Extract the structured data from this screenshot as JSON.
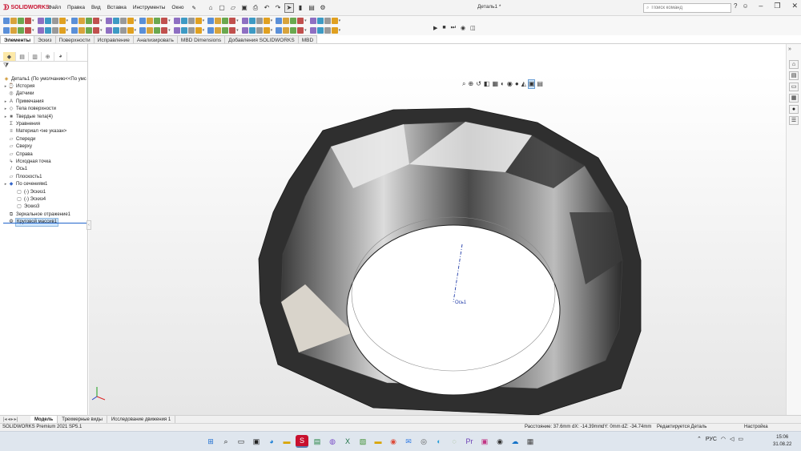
{
  "app": {
    "brand": "SOLIDWORKS",
    "document_title": "Деталь1 *",
    "menus": [
      "Файл",
      "Правка",
      "Вид",
      "Вставка",
      "Инструменты",
      "Окно"
    ],
    "search_placeholder": "Поиск команд"
  },
  "tabs": [
    "Элементы",
    "Эскиз",
    "Поверхности",
    "Исправление",
    "Анализировать",
    "MBD Dimensions",
    "Добавления SOLIDWORKS",
    "MBD"
  ],
  "tree": {
    "root": "Деталь1  (По умолчанию<<По умс",
    "items": [
      {
        "label": "История",
        "icon": "history-icon"
      },
      {
        "label": "Датчики",
        "icon": "sensor-icon"
      },
      {
        "label": "Примечания",
        "icon": "annotation-icon"
      },
      {
        "label": "Тела поверхности",
        "icon": "surface-body-icon"
      },
      {
        "label": "Твердые тела(4)",
        "icon": "solid-body-icon"
      },
      {
        "label": "Уравнения",
        "icon": "equation-icon"
      },
      {
        "label": "Материал <не указан>",
        "icon": "material-icon"
      },
      {
        "label": "Спереди",
        "icon": "plane-icon"
      },
      {
        "label": "Сверху",
        "icon": "plane-icon"
      },
      {
        "label": "Справа",
        "icon": "plane-icon"
      },
      {
        "label": "Исходная точка",
        "icon": "origin-icon"
      },
      {
        "label": "Ось1",
        "icon": "axis-icon"
      },
      {
        "label": "Плоскость1",
        "icon": "plane-icon"
      },
      {
        "label": "По сечениям1",
        "icon": "loft-icon"
      },
      {
        "label": "(-) Эскиз1",
        "icon": "sketch-icon"
      },
      {
        "label": "(-) Эскиз4",
        "icon": "sketch-icon"
      },
      {
        "label": "Эскиз3",
        "icon": "sketch-icon"
      },
      {
        "label": "Зеркальное отражение1",
        "icon": "mirror-icon"
      },
      {
        "label": "Круговой массив1",
        "icon": "circular-pattern-icon"
      }
    ]
  },
  "viewport": {
    "axis_label": "Ось1"
  },
  "bottom_tabs": [
    "Модель",
    "Трехмерные виды",
    "Исследование движения 1"
  ],
  "status": {
    "version": "SOLIDWORKS Premium 2021 SP5.1",
    "distance": "Расстояние: 37.6mm",
    "dx": "dX: -14.39mm",
    "dy": "dY: 0mm",
    "dz": "dZ: -34.74mm",
    "mode": "Редактируется Деталь",
    "settings": "Настройка"
  },
  "taskbar": {
    "language": "РУС",
    "time": "15:06",
    "date": "31.08.22"
  },
  "colors": {
    "accent": "#2266cc",
    "brand_red": "#c8102e",
    "part_dark": "#2f2f2f",
    "part_light": "#efeae0"
  }
}
